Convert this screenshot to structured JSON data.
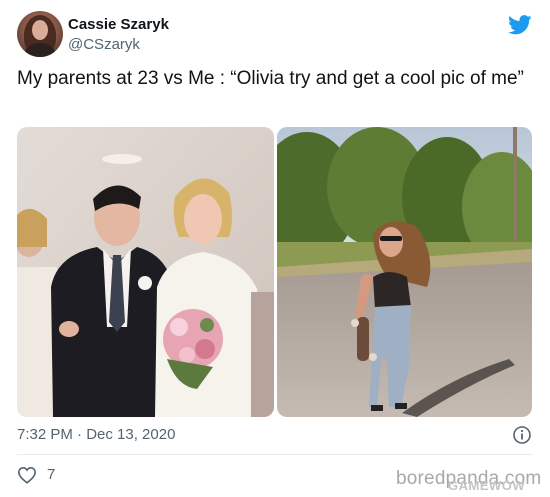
{
  "tweet": {
    "author": {
      "display_name": "Cassie Szaryk",
      "handle": "@CSzaryk",
      "avatar_icon": "avatar-photo"
    },
    "text": "My parents at 23 vs Me : “Olivia try and get a cool pic of me”",
    "media": [
      {
        "name": "wedding-photo",
        "description_icon": "photo"
      },
      {
        "name": "skateboard-photo",
        "description_icon": "photo"
      }
    ],
    "timestamp": "7:32 PM · Dec 13, 2020",
    "likes": "7",
    "icons": {
      "brand": "twitter-bird-icon",
      "info": "info-icon",
      "like": "heart-icon"
    }
  },
  "watermark": {
    "text": "boredpanda.com",
    "secondary": "GAMEWOW"
  },
  "colors": {
    "twitter_blue": "#1d9bf0",
    "secondary_text": "#536471",
    "primary_text": "#0f1419"
  }
}
